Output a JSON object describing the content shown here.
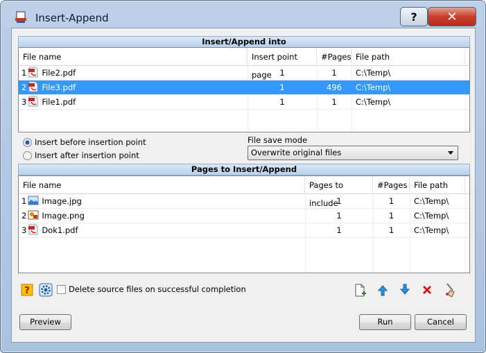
{
  "window": {
    "title": "Insert-Append",
    "help_label": "?",
    "close_label": "✕"
  },
  "into": {
    "header": "Insert/Append into",
    "columns": [
      "File name",
      "Insert point page",
      "#Pages",
      "File path"
    ],
    "rows": [
      {
        "num": "1",
        "name": "File2.pdf",
        "insert_page": "1",
        "pages": "1",
        "path": "C:\\Temp\\",
        "selected": false,
        "icon": "pdf-icon"
      },
      {
        "num": "2",
        "name": "File3.pdf",
        "insert_page": "1",
        "pages": "496",
        "path": "C:\\Temp\\",
        "selected": true,
        "icon": "pdf-icon"
      },
      {
        "num": "3",
        "name": "File1.pdf",
        "insert_page": "1",
        "pages": "1",
        "path": "C:\\Temp\\",
        "selected": false,
        "icon": "pdf-icon"
      }
    ]
  },
  "options": {
    "insert_before": "Insert before insertion point",
    "insert_after": "Insert after insertion point",
    "insert_before_checked": true,
    "save_mode_label": "File save mode",
    "save_mode_value": "Overwrite original files"
  },
  "pages": {
    "header": "Pages to Insert/Append",
    "columns": [
      "File name",
      "Pages to include",
      "#Pages",
      "File path"
    ],
    "rows": [
      {
        "num": "1",
        "name": "Image.jpg",
        "include": "1",
        "pages": "1",
        "path": "C:\\Temp\\",
        "icon": "jpg-image-icon"
      },
      {
        "num": "2",
        "name": "Image.png",
        "include": "1",
        "pages": "1",
        "path": "C:\\Temp\\",
        "icon": "png-image-icon"
      },
      {
        "num": "3",
        "name": "Dok1.pdf",
        "include": "1",
        "pages": "1",
        "path": "C:\\Temp\\",
        "icon": "pdf-icon"
      }
    ]
  },
  "bottom": {
    "delete_label": "Delete source files on successful completion",
    "delete_checked": false,
    "preview_label": "Preview",
    "run_label": "Run",
    "cancel_label": "Cancel"
  }
}
